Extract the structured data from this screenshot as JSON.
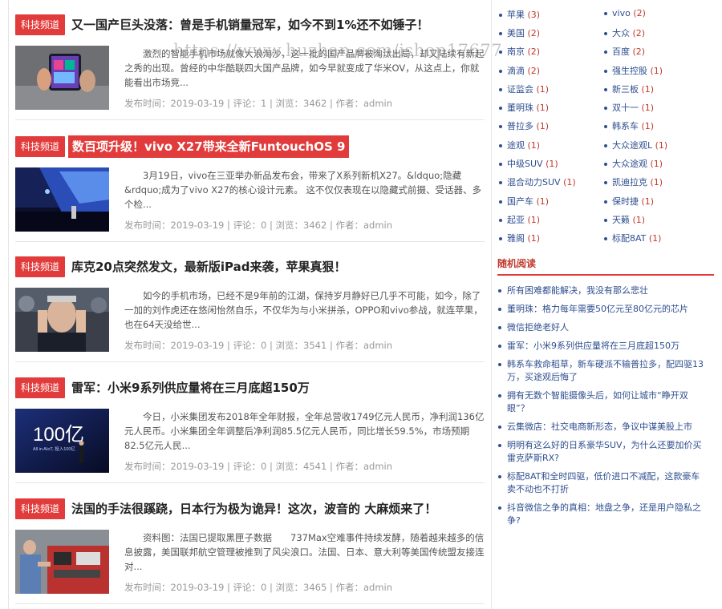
{
  "watermark": "https://www.huzhan.com/ishop17677",
  "articles": [
    {
      "category": "科技频道",
      "title": "又一国产巨头没落：曾是手机销量冠军，如今不到1%还不如锤子！",
      "highlighted": false,
      "summary": "激烈的智能手机市场就像大浪淘沙，这一批的国产品牌被淘汰出局，却又陆续有新起之秀的出现。曾经的中华酷联四大国产品牌，如今早就变成了华米OV，从这点上，你就能看出市场竞...",
      "meta": "发布时间：2019-03-19 | 评论：1 | 浏览：3462 | 作者：admin",
      "thumb": "phone-hands"
    },
    {
      "category": "科技频道",
      "title": "数百项升级！vivo X27带来全新FuntouchOS 9",
      "highlighted": true,
      "summary": "3月19日，vivo在三亚举办新品发布会，带来了X系列新机X27。&ldquo;隐藏&rdquo;成为了vivo X27的核心设计元素。 这不仅仅表现在以隐藏式前摄、受话器、多个检...",
      "meta": "发布时间：2019-03-19 | 评论：0 | 浏览：3462 | 作者：admin",
      "thumb": "stage-blue"
    },
    {
      "category": "科技频道",
      "title": "库克20点突然发文，最新版iPad来袭，苹果真狠！",
      "highlighted": false,
      "summary": "如今的手机市场，已经不是9年前的江湖，保持岁月静好已几乎不可能，如今，除了一加的刘作虎还在悠闲怡然自乐，不仅华为与小米拼杀，OPPO和vivo参战，就连苹果，也在64天没给世...",
      "meta": "发布时间：2019-03-19 | 评论：0 | 浏览：3541 | 作者：admin",
      "thumb": "man-face"
    },
    {
      "category": "科技频道",
      "title": "雷军：小米9系列供应量将在三月底超150万",
      "highlighted": false,
      "summary": "今日，小米集团发布2018年全年财报，全年总营收1749亿元人民币，净利润136亿元人民币。小米集团全年调整后净利润85.5亿元人民币，同比增长59.5%，市场预期82.5亿元人民...",
      "meta": "发布时间：2019-03-19 | 评论：0 | 浏览：4541 | 作者：admin",
      "thumb": "100yi",
      "thumb_text": "100亿",
      "thumb_sub": "All in AIoT, 投入100亿"
    },
    {
      "category": "科技频道",
      "title": "法国的手法很蹊跷，日本行为极为诡异！这次，波音的 大麻烦来了！",
      "highlighted": false,
      "summary": "资料图：法国已提取黑匣子数据　　737Max空难事件持续发酵，随着越来越多的信息披露，美国联邦航空管理被推到了风尖浪口。法国、日本、意大利等美国传统盟友接连对...",
      "meta": "发布时间：2019-03-19 | 评论：0 | 浏览：3465 | 作者：admin",
      "thumb": "blackbox"
    }
  ],
  "tags_left": [
    {
      "name": "苹果",
      "count": "(3)"
    },
    {
      "name": "美国",
      "count": "(2)"
    },
    {
      "name": "南京",
      "count": "(2)"
    },
    {
      "name": "滴滴",
      "count": "(2)"
    },
    {
      "name": "证监会",
      "count": "(1)"
    },
    {
      "name": "董明珠",
      "count": "(1)"
    },
    {
      "name": "普拉多",
      "count": "(1)"
    },
    {
      "name": "途观",
      "count": "(1)"
    },
    {
      "name": "中级SUV",
      "count": "(1)"
    },
    {
      "name": "混合动力SUV",
      "count": "(1)"
    },
    {
      "name": "国产车",
      "count": "(1)"
    },
    {
      "name": "起亚",
      "count": "(1)"
    },
    {
      "name": "雅阁",
      "count": "(1)"
    }
  ],
  "tags_right": [
    {
      "name": "vivo",
      "count": "(2)"
    },
    {
      "name": "大众",
      "count": "(2)"
    },
    {
      "name": "百度",
      "count": "(2)"
    },
    {
      "name": "强生控股",
      "count": "(1)"
    },
    {
      "name": "新三板",
      "count": "(1)"
    },
    {
      "name": "双十一",
      "count": "(1)"
    },
    {
      "name": "韩系车",
      "count": "(1)"
    },
    {
      "name": "大众途观L",
      "count": "(1)"
    },
    {
      "name": "大众途观",
      "count": "(1)"
    },
    {
      "name": "凯迪拉克",
      "count": "(1)"
    },
    {
      "name": "保时捷",
      "count": "(1)"
    },
    {
      "name": "天籁",
      "count": "(1)"
    },
    {
      "name": "标配8AT",
      "count": "(1)"
    }
  ],
  "random_title": "随机阅读",
  "random_list": [
    "所有困难都能解决，我没有那么悲壮",
    "董明珠：格力每年需要50亿元至80亿元的芯片",
    "微信拒绝老好人",
    "雷军：小米9系列供应量将在三月底超150万",
    "韩系车救命稻草，新车硬派不输普拉多，配四驱13万，买途观后悔了",
    "拥有无数个智能摄像头后，如何让城市“睁开双眼”？",
    "云集微店：社交电商新形态，争议中谋美股上市",
    "明明有这么好的日系豪华SUV，为什么还要加价买雷克萨斯RX?",
    "标配8AT和全时四驱，低价进口不减配，这款豪车卖不动也不打折",
    "抖音微信之争的真相：地盘之争，还是用户隐私之争?"
  ],
  "colors": {
    "accent": "#e13b3b",
    "link": "#2f4f8f",
    "count": "#c0392b"
  }
}
